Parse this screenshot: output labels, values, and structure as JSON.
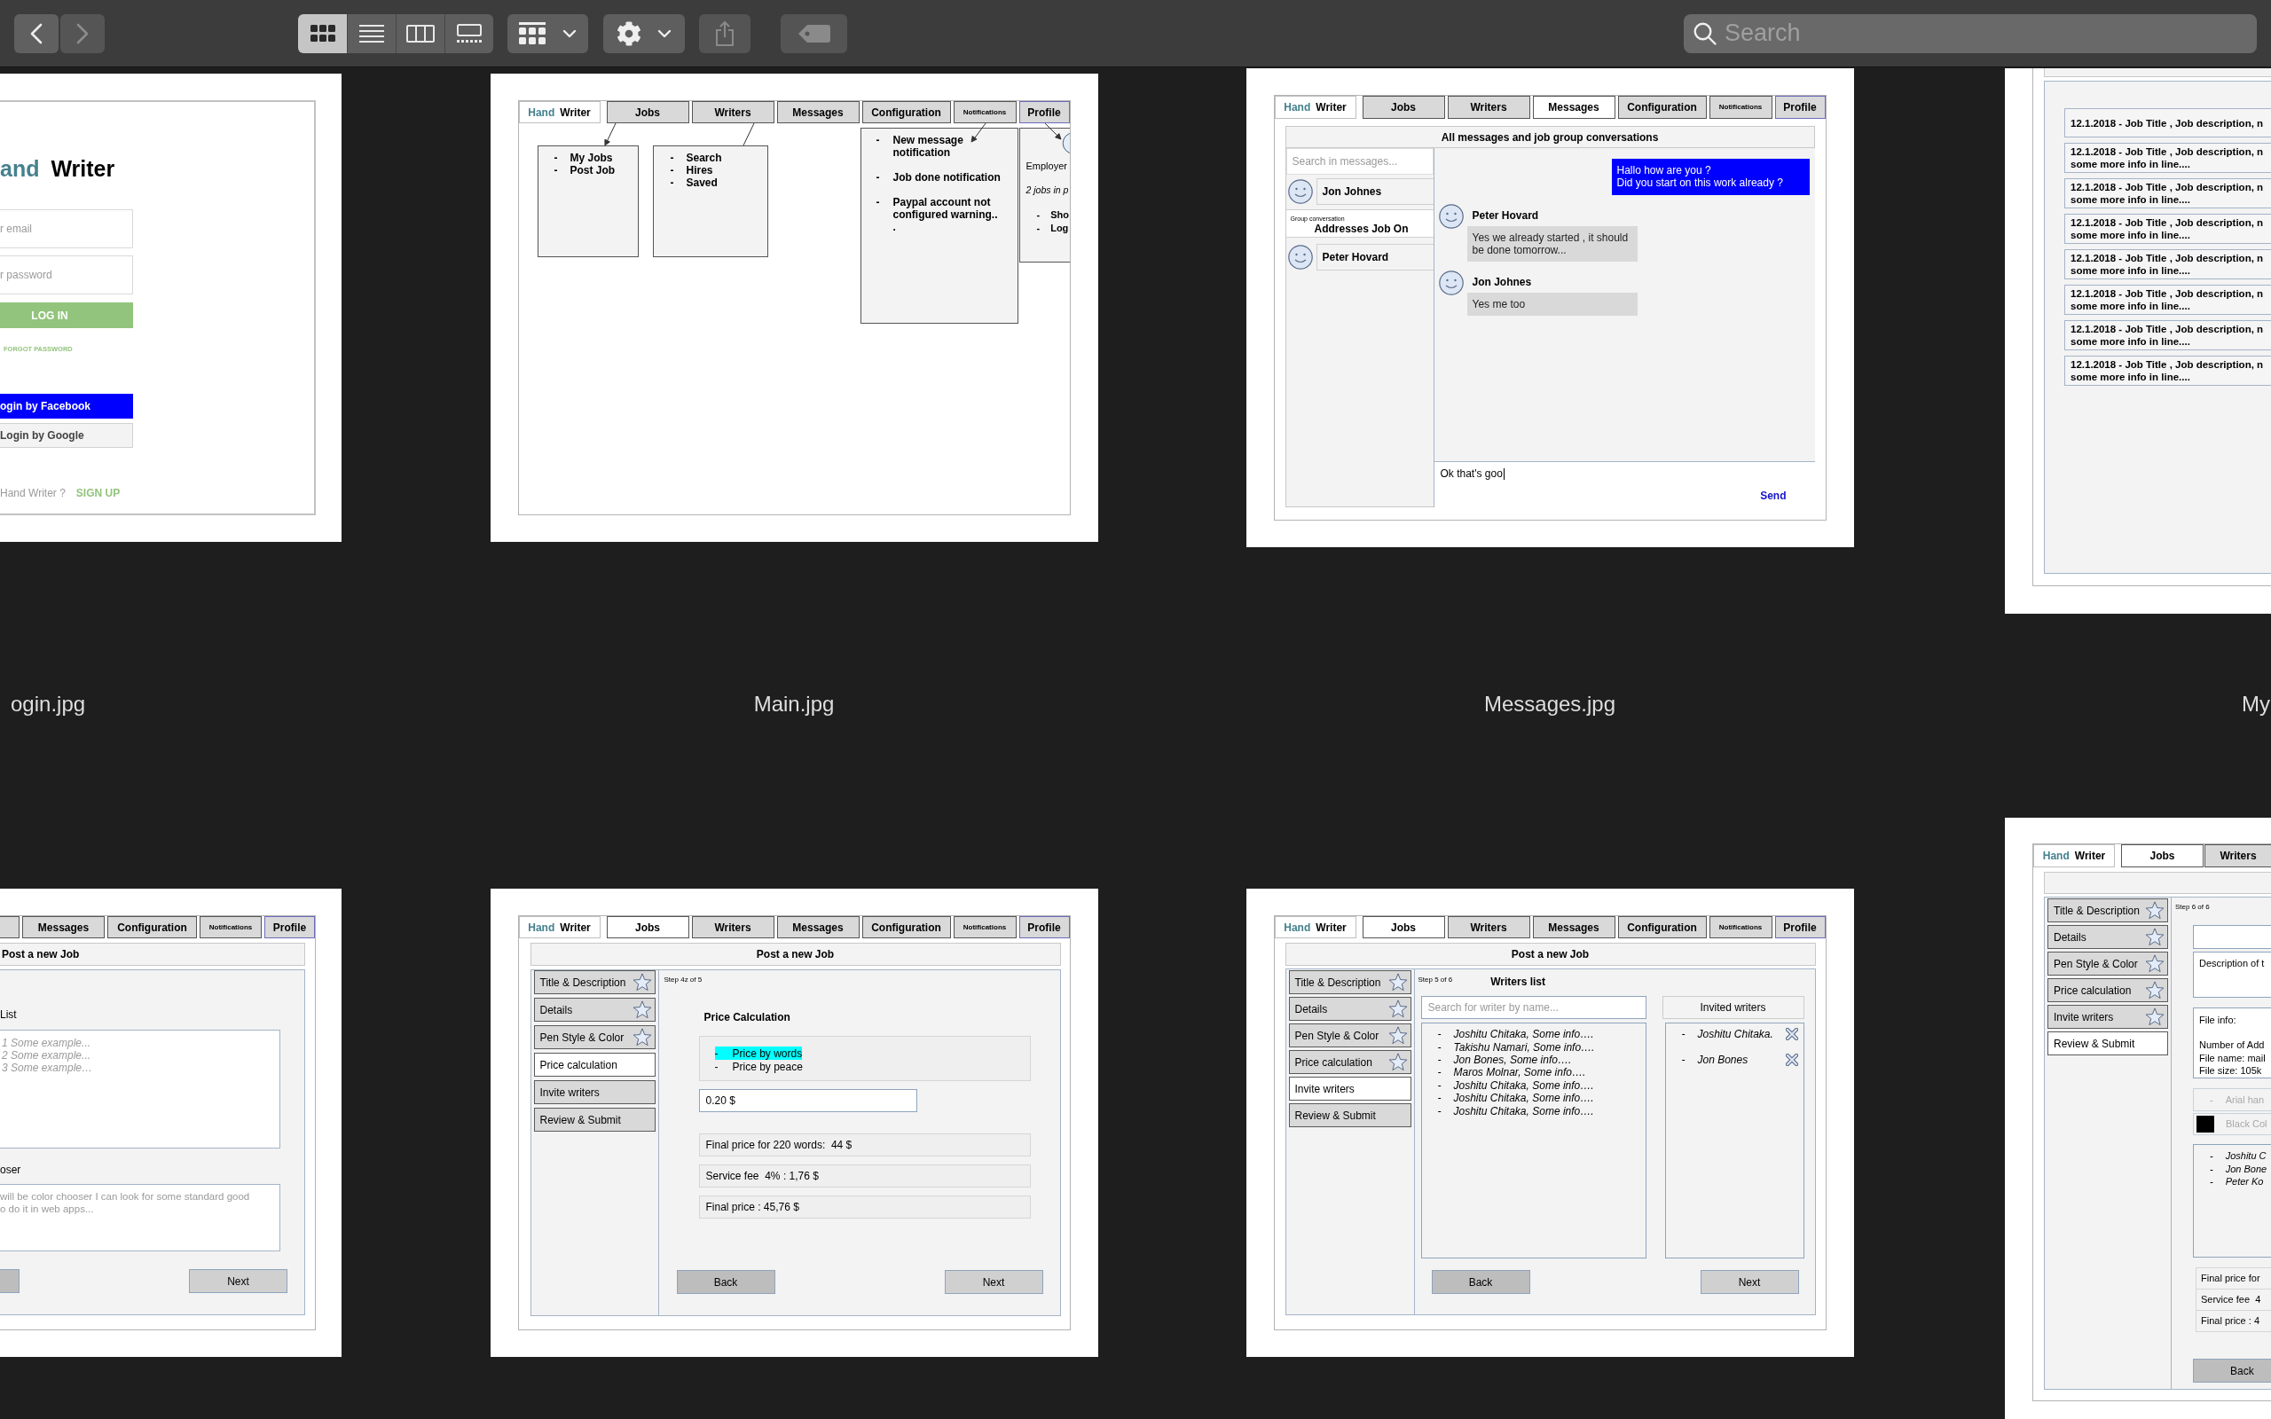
{
  "toolbar": {
    "navigation": [
      {
        "kind": "back",
        "disabled": false
      },
      {
        "kind": "forward",
        "disabled": true
      }
    ],
    "view_modes": [
      {
        "kind": "icons",
        "selected": true
      },
      {
        "kind": "list",
        "selected": false
      },
      {
        "kind": "columns",
        "selected": false
      },
      {
        "kind": "gallery",
        "selected": false
      }
    ],
    "buttons": [
      {
        "kind": "group",
        "disabled": false
      },
      {
        "kind": "action",
        "disabled": false
      },
      {
        "kind": "share",
        "disabled": true
      },
      {
        "kind": "tags",
        "disabled": true
      }
    ],
    "search": {
      "placeholder": "Search"
    }
  },
  "files": [
    {
      "name": "ogin.jpg",
      "preview": {
        "kind": "login",
        "logo": {
          "first": "and",
          "second": "Writer"
        },
        "email": {
          "placeholder": "r email"
        },
        "password": {
          "placeholder": "r password"
        },
        "login_button": "LOG IN",
        "forgot_link": "FORGOT PASSWORD",
        "social_buttons": [
          {
            "kind": "facebook",
            "label": "ogin by Facebook"
          },
          {
            "kind": "google",
            "label": "Login by Google"
          }
        ],
        "signup_prompt": "Hand Writer ?",
        "signup_link": "SIGN UP"
      }
    },
    {
      "name": "Main.jpg",
      "preview": {
        "kind": "main",
        "logo": {
          "first": "Hand",
          "second": "Writer"
        },
        "tabs": [
          {
            "label": "Jobs",
            "selected": false
          },
          {
            "label": "Writers",
            "selected": false
          },
          {
            "label": "Messages",
            "selected": false
          },
          {
            "label": "Configuration",
            "selected": false
          },
          {
            "label": "Notifications",
            "selected": false
          },
          {
            "label": "Profile",
            "selected": false
          }
        ],
        "menus": [
          {
            "kind": "jobs",
            "items": [
              {
                "marker": "-",
                "text": "My Jobs"
              },
              {
                "marker": "-",
                "text": "Post Job"
              }
            ]
          },
          {
            "kind": "writers",
            "items": [
              {
                "marker": "-",
                "text": "Search"
              },
              {
                "marker": "-",
                "text": "Hires"
              },
              {
                "marker": "-",
                "text": "Saved"
              }
            ]
          },
          {
            "kind": "notifications",
            "items": [
              {
                "marker": "-",
                "text": "New message notification"
              },
              {
                "marker": "-",
                "text": "Job done notification"
              },
              {
                "marker": "-",
                "text": "Paypal account not configured warning.."
              }
            ],
            "note": "."
          },
          {
            "kind": "profile",
            "role": "Employer",
            "summary": "2 jobs in p",
            "items": [
              {
                "marker": "-",
                "text": "Sho"
              },
              {
                "marker": "-",
                "text": "Log"
              }
            ]
          }
        ]
      }
    },
    {
      "name": "Messages.jpg",
      "preview": {
        "kind": "messages",
        "logo": {
          "first": "Hand",
          "second": "Writer"
        },
        "tabs": [
          {
            "label": "Jobs",
            "selected": false
          },
          {
            "label": "Writers",
            "selected": false
          },
          {
            "label": "Messages",
            "selected": true
          },
          {
            "label": "Configuration",
            "selected": false
          },
          {
            "label": "Notifications",
            "selected": false
          },
          {
            "label": "Profile",
            "selected": false
          }
        ],
        "title": "All messages and job group conversations",
        "search": {
          "placeholder": "Search in messages..."
        },
        "conversations": [
          {
            "kind": "person",
            "name": "Jon Johnes"
          },
          {
            "kind": "group",
            "caption": "Group conversation",
            "name": "Addresses Job On"
          },
          {
            "kind": "person",
            "name": "Peter Hovard"
          }
        ],
        "messages": [
          {
            "kind": "outgoing",
            "text": "Hallo how are you ?\nDid you start on this work already ?"
          },
          {
            "kind": "incoming",
            "sender": "Peter Hovard",
            "text": "Yes we already started , it should\nbe done tomorrow..."
          },
          {
            "kind": "incoming",
            "sender": "Jon Johnes",
            "text": "Yes me too"
          }
        ],
        "composer": {
          "value": "Ok that's goo"
        },
        "send_button": "Send"
      }
    },
    {
      "name": "My",
      "preview": {
        "kind": "job_list",
        "jobs": [
          {
            "title": "12.1.2018 - Job Title , Job description, n"
          },
          {
            "title": "12.1.2018 - Job Title , Job description, n",
            "details": "some more info in line...."
          },
          {
            "title": "12.1.2018 - Job Title , Job description, n",
            "details": "some more info in line...."
          },
          {
            "title": "12.1.2018 - Job Title , Job description, n",
            "details": "some more info in line...."
          },
          {
            "title": "12.1.2018 - Job Title , Job description, n",
            "details": "some more info in line...."
          },
          {
            "title": "12.1.2018 - Job Title , Job description, n",
            "details": "some more info in line...."
          },
          {
            "title": "12.1.2018 - Job Title , Job description, n",
            "details": "some more info in line...."
          },
          {
            "title": "12.1.2018 - Job Title , Job description, n",
            "details": "some more info in line...."
          }
        ]
      }
    },
    {
      "preview": {
        "kind": "post_job_form",
        "tabs": [
          {
            "label": "Messages",
            "selected": false
          },
          {
            "label": "Configuration",
            "selected": false
          },
          {
            "label": "Notifications",
            "selected": false
          },
          {
            "label": "Profile",
            "selected": false
          }
        ],
        "title": "Post a new Job",
        "fields": [
          {
            "kind": "list",
            "label": "List",
            "lines": [
              "1 Some example...",
              "2 Some example...",
              "3 Some example…"
            ]
          },
          {
            "kind": "text",
            "label": "oser",
            "text": "will be color chooser I can look for some standard good\no do it in web apps..."
          }
        ],
        "next_button": "Next"
      }
    },
    {
      "preview": {
        "kind": "post_job_price",
        "logo": {
          "first": "Hand",
          "second": "Writer"
        },
        "tabs": [
          {
            "label": "Jobs",
            "selected": true
          },
          {
            "label": "Writers",
            "selected": false
          },
          {
            "label": "Messages",
            "selected": false
          },
          {
            "label": "Configuration",
            "selected": false
          },
          {
            "label": "Notifications",
            "selected": false
          },
          {
            "label": "Profile",
            "selected": false
          }
        ],
        "title": "Post a new Job",
        "steps": [
          {
            "label": "Title & Description",
            "selected": false,
            "starred": true
          },
          {
            "label": "Details",
            "selected": false,
            "starred": true
          },
          {
            "label": "Pen Style & Color",
            "selected": false,
            "starred": true
          },
          {
            "label": "Price calculation",
            "selected": true,
            "starred": false
          },
          {
            "label": "Invite writers",
            "selected": false,
            "starred": false
          },
          {
            "label": "Review & Submit",
            "selected": false,
            "starred": false
          }
        ],
        "step_caption": "Step 4z of 5",
        "heading": "Price Calculation",
        "options": [
          {
            "marker": "-",
            "label": "Price by words",
            "selected": true
          },
          {
            "marker": "-",
            "label": "Price by peace",
            "selected": false
          }
        ],
        "rate": {
          "value": "0.20 $"
        },
        "summary": [
          "Final price for 220 words:  44 $",
          "Service fee  4% : 1,76 $",
          "Final price : 45,76 $"
        ],
        "buttons": [
          "Back",
          "Next"
        ]
      }
    },
    {
      "preview": {
        "kind": "post_job_writers",
        "logo": {
          "first": "Hand",
          "second": "Writer"
        },
        "tabs": [
          {
            "label": "Jobs",
            "selected": true
          },
          {
            "label": "Writers",
            "selected": false
          },
          {
            "label": "Messages",
            "selected": false
          },
          {
            "label": "Configuration",
            "selected": false
          },
          {
            "label": "Notifications",
            "selected": false
          },
          {
            "label": "Profile",
            "selected": false
          }
        ],
        "title": "Post a new Job",
        "steps": [
          {
            "label": "Title & Description",
            "selected": false,
            "starred": true
          },
          {
            "label": "Details",
            "selected": false,
            "starred": true
          },
          {
            "label": "Pen Style & Color",
            "selected": false,
            "starred": true
          },
          {
            "label": "Price calculation",
            "selected": false,
            "starred": true
          },
          {
            "label": "Invite writers",
            "selected": true,
            "starred": false
          },
          {
            "label": "Review & Submit",
            "selected": false,
            "starred": false
          }
        ],
        "step_caption": "Step 5 of 6",
        "heading": "Writers list",
        "search": {
          "placeholder": "Search for writer by name..."
        },
        "invited_heading": "Invited writers",
        "writers": [
          {
            "marker": "-",
            "text": "Joshitu Chitaka, Some info…."
          },
          {
            "marker": "-",
            "text": "Takishu Namari, Some info…."
          },
          {
            "marker": "-",
            "text": "Jon Bones, Some info…."
          },
          {
            "marker": "-",
            "text": "Maros Molnar, Some info…."
          },
          {
            "marker": "-",
            "text": "Joshitu Chitaka, Some info…."
          },
          {
            "marker": "-",
            "text": "Joshitu Chitaka, Some info…."
          },
          {
            "marker": "-",
            "text": "Joshitu Chitaka, Some info…."
          }
        ],
        "invited": [
          {
            "marker": "-",
            "text": "Joshitu Chitaka."
          },
          {
            "marker": "-",
            "text": "Jon Bones"
          }
        ],
        "buttons": [
          "Back",
          "Next"
        ]
      }
    },
    {
      "preview": {
        "kind": "post_job_review",
        "logo": {
          "first": "Hand",
          "second": "Writer"
        },
        "tabs": [
          {
            "label": "Jobs",
            "selected": true
          },
          {
            "label": "Writers",
            "selected": false
          }
        ],
        "steps": [
          {
            "label": "Title & Description",
            "selected": false,
            "starred": true
          },
          {
            "label": "Details",
            "selected": false,
            "starred": true
          },
          {
            "label": "Pen Style & Color",
            "selected": false,
            "starred": true
          },
          {
            "label": "Price calculation",
            "selected": false,
            "starred": true
          },
          {
            "label": "Invite writers",
            "selected": false,
            "starred": true
          },
          {
            "label": "Review & Submit",
            "selected": true,
            "starred": false
          }
        ],
        "step_caption": "Step 6 of 6",
        "description": "Description of t",
        "file_info": {
          "heading": "File info:",
          "lines": [
            "Number of Add",
            "File name: mail",
            "File size: 105k"
          ]
        },
        "pen_style": {
          "marker": "-",
          "text": "Arial han"
        },
        "pen_color": {
          "text": "Black Col"
        },
        "invited": [
          {
            "marker": "-",
            "text": "Joshitu C"
          },
          {
            "marker": "-",
            "text": "Jon Bone"
          },
          {
            "marker": "-",
            "text": "Peter Ko"
          }
        ],
        "summary": [
          "Final price for",
          "Service fee  4",
          "Final price : 4"
        ],
        "back_button": "Back"
      }
    }
  ]
}
